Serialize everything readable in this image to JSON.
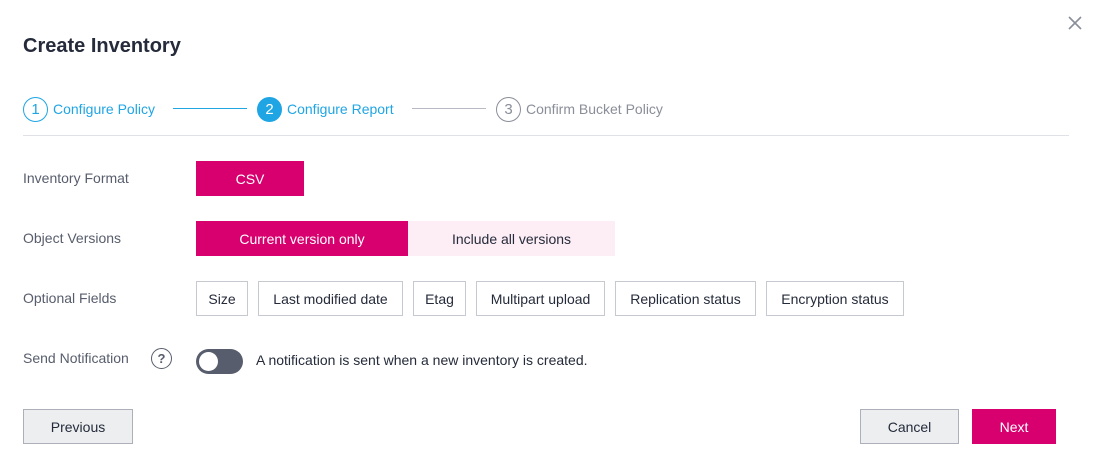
{
  "dialog": {
    "title": "Create Inventory",
    "close_icon": "close-icon"
  },
  "steps": [
    {
      "number": "1",
      "label": "Configure Policy",
      "state": "done"
    },
    {
      "number": "2",
      "label": "Configure Report",
      "state": "active"
    },
    {
      "number": "3",
      "label": "Confirm Bucket Policy",
      "state": "todo"
    }
  ],
  "form": {
    "inventory_format": {
      "label": "Inventory Format",
      "options": [
        "CSV"
      ],
      "selected": "CSV"
    },
    "object_versions": {
      "label": "Object Versions",
      "options": [
        "Current version only",
        "Include all versions"
      ],
      "selected": "Current version only"
    },
    "optional_fields": {
      "label": "Optional Fields",
      "options": [
        "Size",
        "Last modified date",
        "Etag",
        "Multipart upload",
        "Replication status",
        "Encryption status"
      ]
    },
    "send_notification": {
      "label": "Send Notification",
      "help_icon_text": "?",
      "enabled": false,
      "description": "A notification is sent when a new inventory is created."
    }
  },
  "footer": {
    "previous_label": "Previous",
    "cancel_label": "Cancel",
    "next_label": "Next"
  },
  "colors": {
    "accent": "#d8006e",
    "accent_light": "#fdeef6",
    "step_blue": "#1fa5e4",
    "toggle_off": "#575d6c"
  }
}
